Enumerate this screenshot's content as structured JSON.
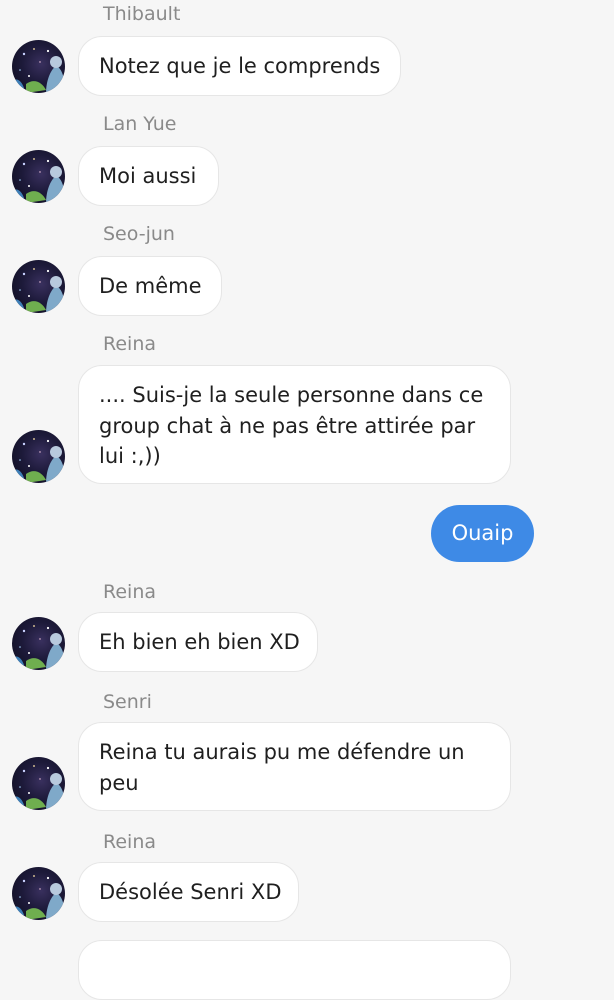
{
  "conversation": {
    "messages": [
      {
        "sender": "Thibault",
        "text": "Notez que je le comprends"
      },
      {
        "sender": "Lan Yue",
        "text": "Moi aussi"
      },
      {
        "sender": "Seo-jun",
        "text": "De même"
      },
      {
        "sender": "Reina",
        "text": ".... Suis-je la seule personne dans ce group chat à ne pas être attirée par lui :,))"
      },
      {
        "outgoing_text": "Ouaip"
      },
      {
        "sender": "Reina",
        "text": "Eh bien eh bien XD"
      },
      {
        "sender": "Senri",
        "text": "Reina tu aurais pu me défendre un peu"
      },
      {
        "sender": "Reina",
        "text": "Désolée Senri XD"
      }
    ]
  },
  "colors": {
    "background": "#f6f6f6",
    "incoming_bubble": "#ffffff",
    "outgoing_bubble": "#3e8ae6",
    "sender_name": "#8a8a8a"
  },
  "icons": {
    "avatar": "avatar-icon"
  }
}
